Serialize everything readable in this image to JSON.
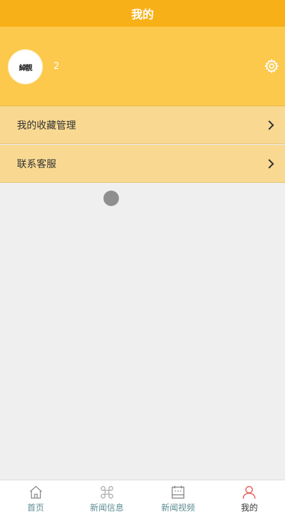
{
  "header": {
    "title": "我的"
  },
  "profile": {
    "avatar_logo_text": "綽靚",
    "username": "2"
  },
  "menu": [
    {
      "label": "我的收藏管理"
    },
    {
      "label": "联系客服"
    }
  ],
  "tabbar": {
    "active": 3,
    "tabs": [
      {
        "label": "首页",
        "icon": "home-icon"
      },
      {
        "label": "新闻信息",
        "icon": "command-icon"
      },
      {
        "label": "新闻视频",
        "icon": "calendar-icon"
      },
      {
        "label": "我的",
        "icon": "person-icon"
      }
    ]
  },
  "colors": {
    "header": "#f8b018",
    "profile": "#fcc94d",
    "menu_item": "#f9d992",
    "tab_label": "#5c8c92",
    "tab_active_icon": "#e4554e"
  }
}
